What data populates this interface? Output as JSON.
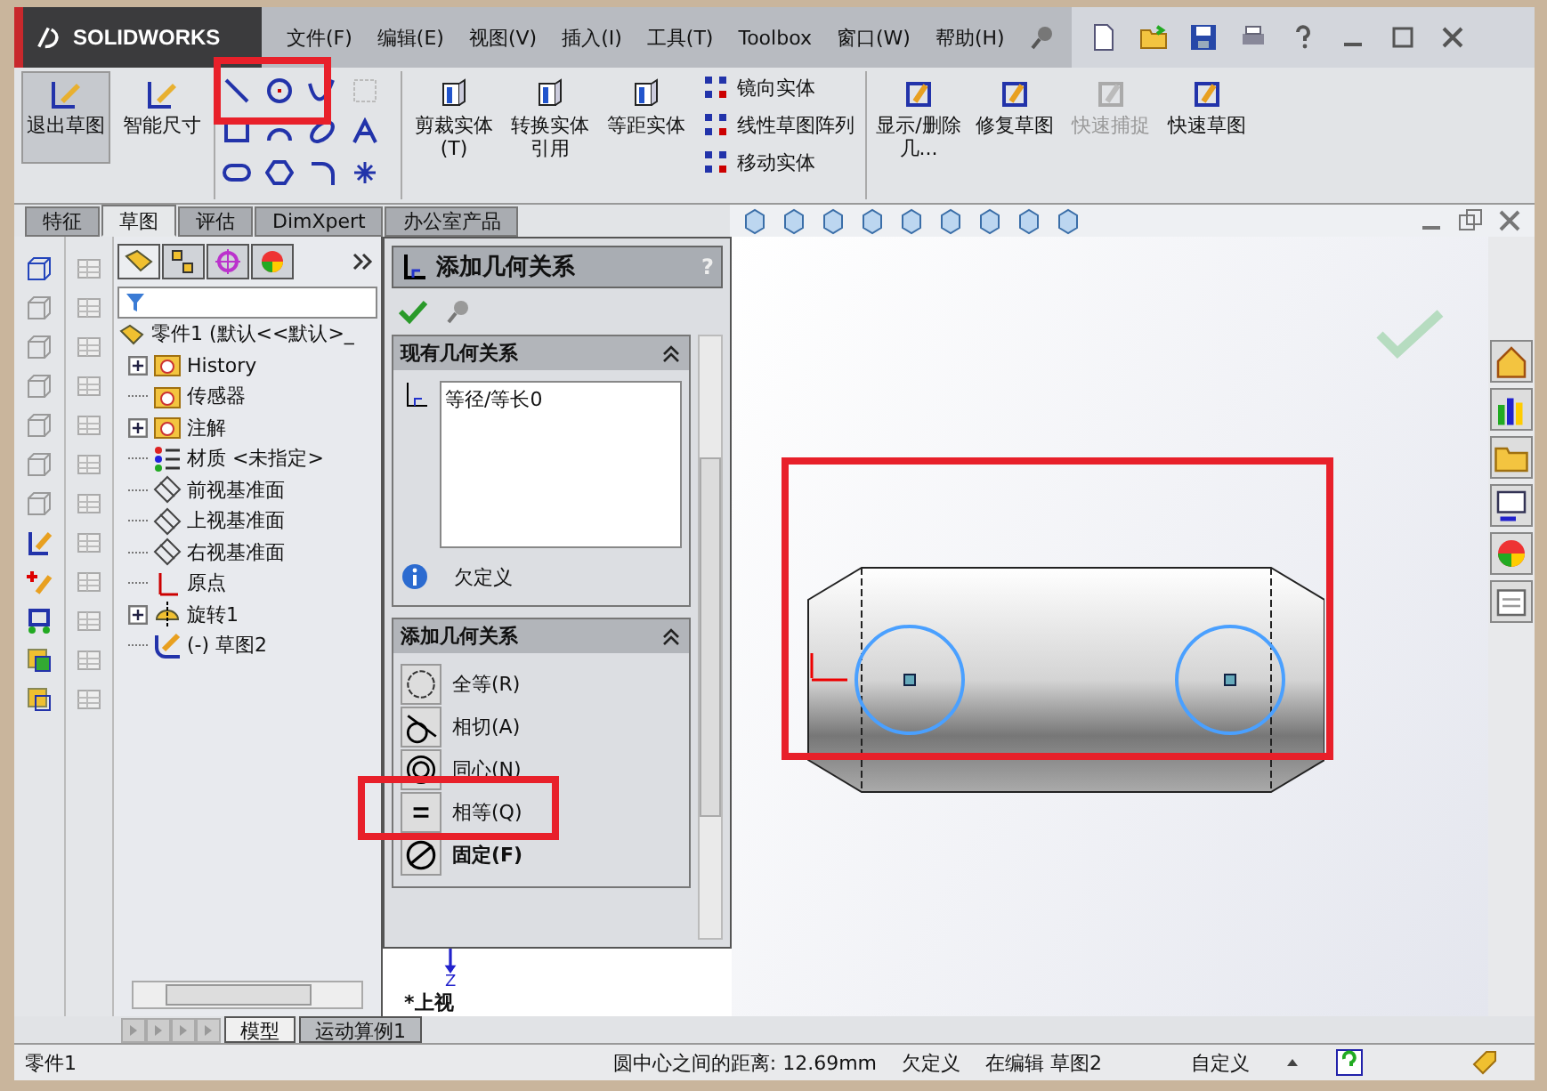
{
  "app": {
    "logo": "SOLIDWORKS"
  },
  "menu": [
    "文件(F)",
    "编辑(E)",
    "视图(V)",
    "插入(I)",
    "工具(T)",
    "Toolbox",
    "窗口(W)",
    "帮助(H)"
  ],
  "ribbon": {
    "large_buttons": [
      {
        "label": "退出草图",
        "selected": true
      },
      {
        "label": "智能尺寸",
        "selected": false
      }
    ],
    "mid_buttons": [
      "剪裁实体(T)",
      "转换实体引用",
      "等距实体"
    ],
    "list_buttons": [
      "镜向实体",
      "线性草图阵列",
      "移动实体"
    ],
    "right_buttons": [
      {
        "label": "显示/删除几...",
        "disabled": false
      },
      {
        "label": "修复草图",
        "disabled": false
      },
      {
        "label": "快速捕捉",
        "disabled": true
      },
      {
        "label": "快速草图",
        "disabled": false
      }
    ]
  },
  "tabs": [
    {
      "label": "特征",
      "selected": false
    },
    {
      "label": "草图",
      "selected": true
    },
    {
      "label": "评估",
      "selected": false
    },
    {
      "label": "DimXpert",
      "selected": false
    },
    {
      "label": "办公室产品",
      "selected": false
    }
  ],
  "tree": {
    "root": "零件1  (默认<<默认>_",
    "items": [
      {
        "label": "History",
        "kind": "history",
        "expandable": true
      },
      {
        "label": "传感器",
        "kind": "sensor",
        "expandable": false
      },
      {
        "label": "注解",
        "kind": "annotation",
        "expandable": true
      },
      {
        "label": "材质 <未指定>",
        "kind": "material",
        "expandable": false
      },
      {
        "label": "前视基准面",
        "kind": "plane",
        "expandable": false
      },
      {
        "label": "上视基准面",
        "kind": "plane",
        "expandable": false
      },
      {
        "label": "右视基准面",
        "kind": "plane",
        "expandable": false
      },
      {
        "label": "原点",
        "kind": "origin",
        "expandable": false
      },
      {
        "label": "旋转1",
        "kind": "feature",
        "expandable": true
      },
      {
        "label": "(-) 草图2",
        "kind": "sketch",
        "expandable": false
      }
    ]
  },
  "property_manager": {
    "title": "添加几何关系",
    "help": "?",
    "existing": {
      "heading": "现有几何关系",
      "items": [
        "等径/等长0"
      ],
      "status": "欠定义"
    },
    "add": {
      "heading": "添加几何关系",
      "options": [
        {
          "label": "全等(R)",
          "kind": "coradial",
          "bold": false
        },
        {
          "label": "相切(A)",
          "kind": "tangent",
          "bold": false
        },
        {
          "label": "同心(N)",
          "kind": "concentric",
          "bold": false
        },
        {
          "label": "相等(Q)",
          "kind": "equal",
          "bold": false
        },
        {
          "label": "固定(F)",
          "kind": "fix",
          "bold": true
        }
      ]
    }
  },
  "viewport": {
    "axis": "Z",
    "view_label": "*上视"
  },
  "bottom_tabs": [
    {
      "label": "模型",
      "selected": true
    },
    {
      "label": "运动算例1",
      "selected": false
    }
  ],
  "status_bar": [
    "零件1",
    "圆中心之间的距离:  12.69mm",
    "欠定义",
    "在编辑 草图2",
    "自定义"
  ]
}
